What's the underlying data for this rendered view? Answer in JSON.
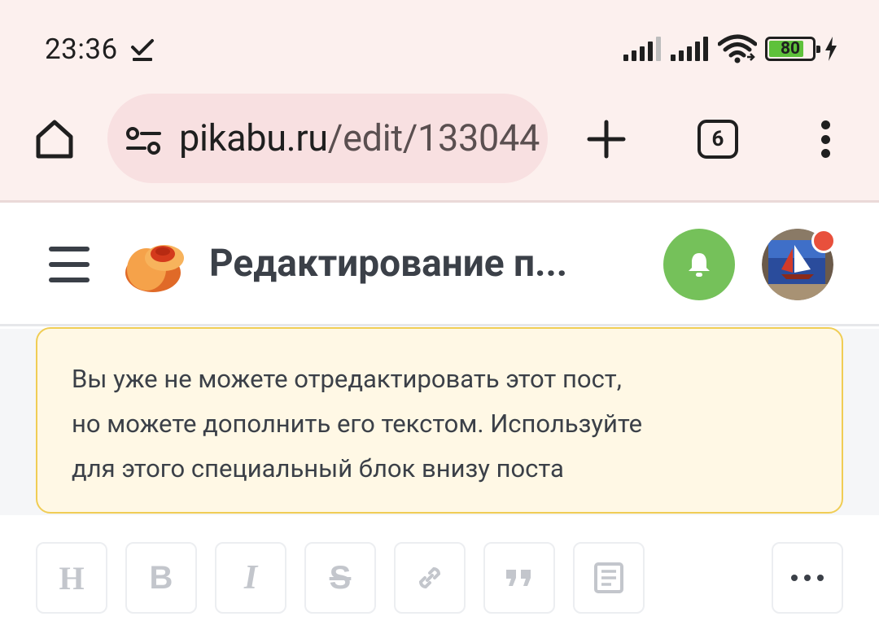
{
  "status_bar": {
    "time": "23:36",
    "battery_level": "80",
    "battery_fill_percent": 80,
    "icons": [
      "download-done-icon",
      "signal-icon",
      "signal-icon",
      "wifi-icon",
      "battery-icon",
      "charging-icon"
    ]
  },
  "browser": {
    "url_domain": "pikabu.ru",
    "url_path": "/edit/133044",
    "tab_count": "6",
    "icons": [
      "home-icon",
      "site-settings-icon",
      "new-tab-icon",
      "tabs-icon",
      "more-options-icon"
    ]
  },
  "header": {
    "title": "Редактирование п...",
    "accent_color": "#75c15a",
    "notification_dot_color": "#e8503c",
    "icons": [
      "menu-icon",
      "pikabu-logo",
      "bell-icon",
      "avatar"
    ]
  },
  "notice": {
    "lines": [
      "Вы уже не можете отредактировать этот пост,",
      "но можете дополнить его текстом. Используйте",
      "для этого специальный блок внизу поста"
    ],
    "background": "#fff8e5",
    "border_color": "#f0cd55"
  },
  "editor_toolbar": {
    "heading_label": "H",
    "bold_label": "B",
    "italic_label": "I",
    "strike_label": "S",
    "buttons": [
      {
        "name": "heading",
        "enabled": false
      },
      {
        "name": "bold",
        "enabled": false
      },
      {
        "name": "italic",
        "enabled": false
      },
      {
        "name": "strikethrough",
        "enabled": false
      },
      {
        "name": "link",
        "enabled": false
      },
      {
        "name": "quote",
        "enabled": false
      },
      {
        "name": "spoiler",
        "enabled": false
      },
      {
        "name": "more",
        "enabled": true
      }
    ]
  }
}
